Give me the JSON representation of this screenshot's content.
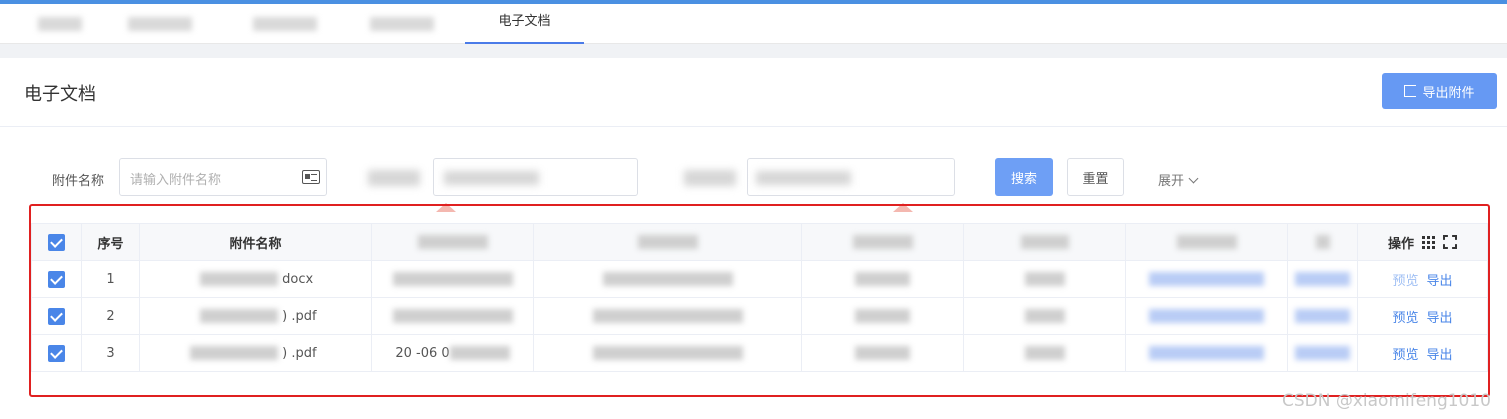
{
  "tabs": [
    {
      "label": "首页",
      "blurred": true
    },
    {
      "label": "管理",
      "blurred": true
    },
    {
      "label": "",
      "blurred": true
    },
    {
      "label": "",
      "blurred": true
    },
    {
      "label": "电子文档",
      "blurred": false,
      "active": true
    }
  ],
  "page": {
    "title": "电子文档",
    "export_label": "导出附件"
  },
  "filters": {
    "attachment_name_label": "附件名称",
    "attachment_name_placeholder": "请输入附件名称",
    "search_label": "搜索",
    "reset_label": "重置",
    "expand_label": "展开"
  },
  "table": {
    "headers": {
      "index": "序号",
      "name": "附件名称",
      "ops": "操作"
    },
    "rows": [
      {
        "index": "1",
        "name": "docx",
        "time": "",
        "preview": "预览",
        "export": "导出"
      },
      {
        "index": "2",
        "name": ") .pdf",
        "time": "",
        "preview": "预览",
        "export": "导出"
      },
      {
        "index": "3",
        "name": ") .pdf",
        "time": "20 -06 0",
        "preview": "预览",
        "export": "导出"
      }
    ]
  },
  "watermark": "CSDN @xiaomifeng1010",
  "colors": {
    "accent": "#4a86e8",
    "primary_button": "#6699f3",
    "highlight": "#e02020"
  }
}
